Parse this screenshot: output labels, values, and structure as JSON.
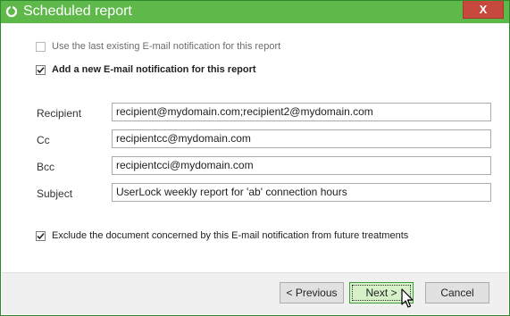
{
  "window": {
    "title": "Scheduled report",
    "close_label": "X",
    "accent_color": "#5fb84a",
    "close_color": "#c7483c"
  },
  "options": {
    "use_existing": {
      "label": "Use the last existing E-mail notification for this report",
      "checked": false,
      "enabled": false
    },
    "add_new": {
      "label": "Add a new E-mail notification for this report",
      "checked": true,
      "enabled": true
    }
  },
  "fields": {
    "recipient": {
      "label": "Recipient",
      "value": "recipient@mydomain.com;recipient2@mydomain.com"
    },
    "cc": {
      "label": "Cc",
      "value": "recipientcc@mydomain.com"
    },
    "bcc": {
      "label": "Bcc",
      "value": "recipientcci@mydomain.com"
    },
    "subject": {
      "label": "Subject",
      "value": "UserLock weekly report for 'ab' connection hours"
    }
  },
  "exclude": {
    "label": "Exclude the document concerned by this E-mail notification from future treatments",
    "checked": true
  },
  "buttons": {
    "previous": "< Previous",
    "next": "Next >",
    "cancel": "Cancel"
  },
  "icons": {
    "app": "app-ring-icon",
    "close": "close-icon",
    "check": "checkmark-icon",
    "cursor": "mouse-pointer-icon"
  }
}
